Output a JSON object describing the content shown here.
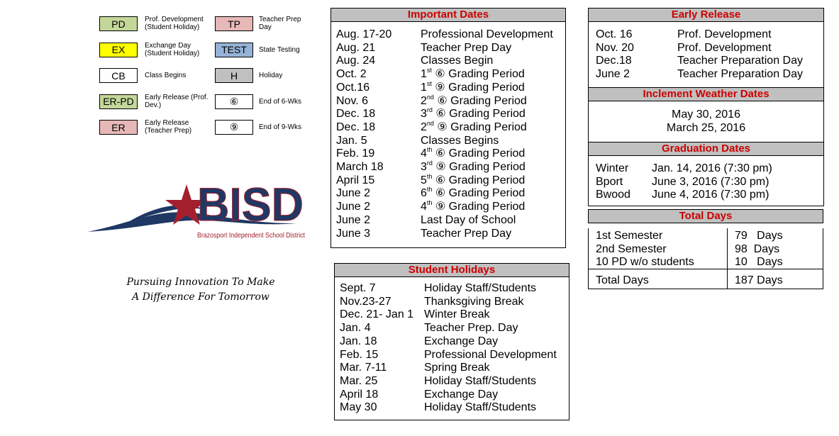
{
  "legend": [
    {
      "code": "PD",
      "label": "Prof. Development (Student Holiday)",
      "color": "#c4d79b"
    },
    {
      "code": "EX",
      "label": "Exchange Day (Student Holiday)",
      "color": "#ffff00"
    },
    {
      "code": "CB",
      "label": "Class Begins",
      "color": "#ffffff"
    },
    {
      "code": "ER-PD",
      "label": "Early Release (Prof. Dev.)",
      "color": "#c4d79b"
    },
    {
      "code": "ER",
      "label": "Early Release (Teacher Prep)",
      "color": "#e6b8b7"
    },
    {
      "code": "TP",
      "label": "Teacher Prep Day",
      "color": "#e6b8b7"
    },
    {
      "code": "TEST",
      "label": "State Testing",
      "color": "#95b3d7"
    },
    {
      "code": "H",
      "label": "Holiday",
      "color": "#c0c0c0"
    },
    {
      "code": "⑥",
      "label": "End of 6-Wks",
      "color": "#ffffff"
    },
    {
      "code": "⑨",
      "label": "End of 9-Wks",
      "color": "#ffffff"
    }
  ],
  "logo": {
    "text": "BISD",
    "subtitle": "Brazosport Independent School District",
    "navy": "#1f3864",
    "red": "#a31f2e"
  },
  "tagline": [
    "Pursuing Innovation To Make",
    "A Difference For Tomorrow"
  ],
  "important_dates": {
    "title": "Important Dates",
    "rows": [
      {
        "date": "Aug. 17-20",
        "event": "Professional Development"
      },
      {
        "date": "Aug. 21",
        "event": "Teacher Prep Day"
      },
      {
        "date": "Aug. 24",
        "event": "Classes Begin"
      },
      {
        "date": "Oct. 2",
        "num": "1",
        "sup": "st",
        "symbol": "⑥",
        "event": "Grading Period"
      },
      {
        "date": "Oct.16",
        "num": "1",
        "sup": "st",
        "symbol": "⑨",
        "event": "Grading Period"
      },
      {
        "date": "Nov. 6",
        "num": "2",
        "sup": "nd",
        "symbol": "⑥",
        "event": "Grading Period"
      },
      {
        "date": "Dec. 18",
        "num": "3",
        "sup": "rd",
        "symbol": "⑥",
        "event": "Grading Period"
      },
      {
        "date": "Dec. 18",
        "num": "2",
        "sup": "nd",
        "symbol": "⑨",
        "event": "Grading Period"
      },
      {
        "date": "Jan. 5",
        "event": "Classes Begins"
      },
      {
        "date": "Feb. 19",
        "num": "4",
        "sup": "th",
        "symbol": "⑥",
        "event": "Grading Period"
      },
      {
        "date": "March 18",
        "num": "3",
        "sup": "rd",
        "symbol": "⑨",
        "event": "Grading Period"
      },
      {
        "date": "April 15",
        "num": "5",
        "sup": "th",
        "symbol": "⑥",
        "event": "Grading Period"
      },
      {
        "date": "June 2",
        "num": "6",
        "sup": "th",
        "symbol": "⑥",
        "event": "Grading Period"
      },
      {
        "date": "June 2",
        "num": "4",
        "sup": "th",
        "symbol": "⑨",
        "event": "Grading Period"
      },
      {
        "date": "June 2",
        "event": "Last Day of School"
      },
      {
        "date": "June 3",
        "event": "Teacher Prep Day"
      }
    ]
  },
  "student_holidays": {
    "title": "Student Holidays",
    "rows": [
      {
        "date": "Sept. 7",
        "event": "Holiday Staff/Students"
      },
      {
        "date": "Nov.23-27",
        "event": "Thanksgiving Break"
      },
      {
        "date": "Dec. 21- Jan 1",
        "event": "Winter Break"
      },
      {
        "date": "Jan. 4",
        "event": "Teacher Prep. Day"
      },
      {
        "date": "Jan. 18",
        "event": "Exchange Day"
      },
      {
        "date": "Feb. 15",
        "event": "Professional Development"
      },
      {
        "date": "Mar. 7-11",
        "event": "Spring Break"
      },
      {
        "date": "Mar. 25",
        "event": "Holiday Staff/Students"
      },
      {
        "date": "April 18",
        "event": "Exchange Day"
      },
      {
        "date": "May 30",
        "event": "Holiday Staff/Students"
      }
    ]
  },
  "early_release": {
    "title": "Early Release",
    "rows": [
      {
        "date": "Oct. 16",
        "event": "Prof. Development"
      },
      {
        "date": "Nov. 20",
        "event": "Prof. Development"
      },
      {
        "date": "Dec.18",
        "event": "Teacher Preparation Day"
      },
      {
        "date": "June 2",
        "event": "Teacher Preparation Day"
      }
    ]
  },
  "inclement": {
    "title": "Inclement Weather Dates",
    "dates": [
      "May 30, 2016",
      "March 25, 2016"
    ]
  },
  "graduation": {
    "title": "Graduation Dates",
    "rows": [
      {
        "school": "Winter",
        "date": "Jan. 14, 2016 (7:30 pm)"
      },
      {
        "school": "Bport",
        "date": "June 3, 2016 (7:30 pm)"
      },
      {
        "school": "Bwood",
        "date": "June 4, 2016 (7:30 pm)"
      }
    ]
  },
  "total_days": {
    "title": "Total Days",
    "rows": [
      {
        "label": "1st Semester",
        "value": "79   Days"
      },
      {
        "label": "2nd Semester",
        "value": "98  Days"
      },
      {
        "label": "10 PD w/o students",
        "value": "10   Days"
      }
    ],
    "total": {
      "label": "Total Days",
      "value": "187 Days"
    }
  }
}
